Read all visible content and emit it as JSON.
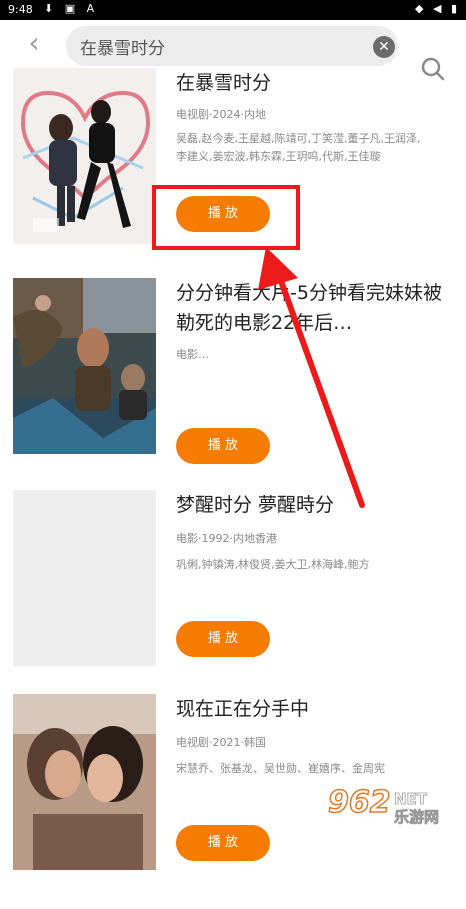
{
  "status_bar": {
    "time": "9:48",
    "left_icons": "⬇ ▣ A",
    "right_icons": "◆ ◀ ▮"
  },
  "search": {
    "back_icon": "back-chevron-icon",
    "value": "在暴雪时分",
    "clear_icon": "clear-icon",
    "search_icon": "search-icon"
  },
  "results": [
    {
      "title": "在暴雪时分",
      "meta": "电视剧·2024·内地",
      "cast": "吴磊,赵今麦,王星越,陈靖可,丁笑滢,董子凡,王润泽,李建义,姜宏波,韩东霖,王玥呜,代斯,王佳璇",
      "play_label": "播 放"
    },
    {
      "title": "分分钟看大片-5分钟看完妹妹被勒死的电影22年后…",
      "meta": "电影…",
      "cast": "",
      "play_label": "播 放"
    },
    {
      "title": "梦醒时分 夢醒時分",
      "meta": "电影·1992·内地香港",
      "cast": "巩俐,钟镇涛,林俊贤,姜大卫,林海峰,鲍方",
      "play_label": "播 放"
    },
    {
      "title": "现在正在分手中",
      "meta": "电视剧·2021·韩国",
      "cast": "宋慧乔、张基龙、吴世勋、崔嬉序、金周宪",
      "play_label": "播 放"
    }
  ],
  "watermark": {
    "brand": "962",
    "suffix": "NET",
    "text": "乐游网"
  },
  "colors": {
    "accent": "#f57c00",
    "annotation": "#ec1a1a",
    "status_bg": "#000000"
  }
}
